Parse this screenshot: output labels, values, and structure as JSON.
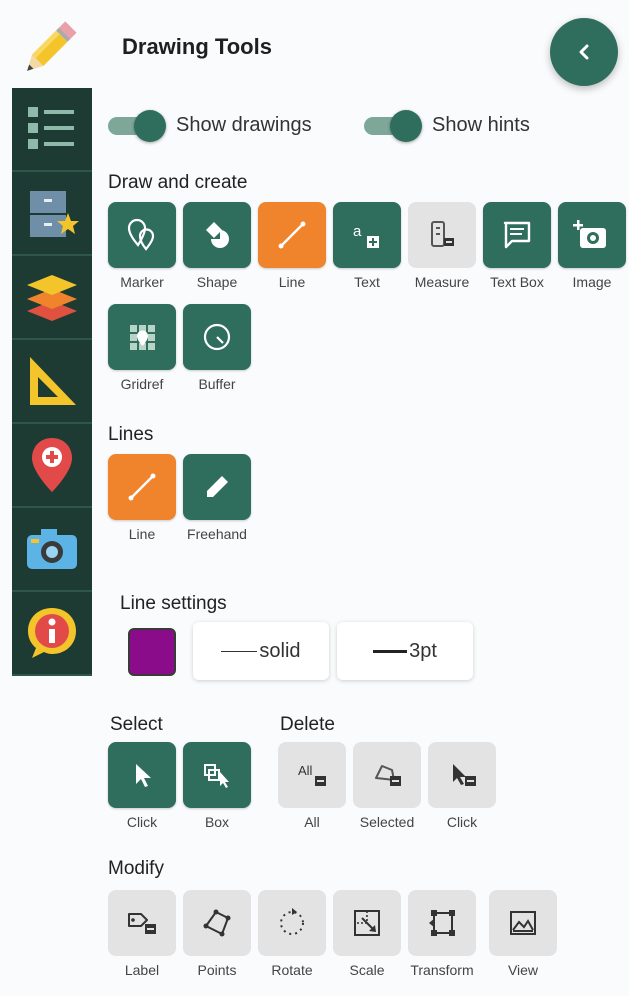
{
  "header": {
    "title": "Drawing Tools"
  },
  "toggles": [
    {
      "label": "Show drawings",
      "on": true
    },
    {
      "label": "Show hints",
      "on": true
    }
  ],
  "sections": {
    "draw": "Draw and create",
    "lines": "Lines",
    "line_settings": "Line settings",
    "select": "Select",
    "delete": "Delete",
    "modify": "Modify"
  },
  "draw_tools": [
    {
      "label": "Marker",
      "icon": "marker-icon"
    },
    {
      "label": "Shape",
      "icon": "shape-icon"
    },
    {
      "label": "Line",
      "icon": "line-icon",
      "active": true
    },
    {
      "label": "Text",
      "icon": "text-icon"
    },
    {
      "label": "Measure",
      "icon": "measure-icon",
      "disabled": true
    },
    {
      "label": "Text Box",
      "icon": "text-box-icon"
    },
    {
      "label": "Image",
      "icon": "image-icon"
    },
    {
      "label": "Gridref",
      "icon": "gridref-icon"
    },
    {
      "label": "Buffer",
      "icon": "buffer-icon"
    }
  ],
  "line_tools": [
    {
      "label": "Line",
      "icon": "line-icon",
      "active": true
    },
    {
      "label": "Freehand",
      "icon": "pencil-icon"
    }
  ],
  "line_settings": {
    "color": "#8a0c8a",
    "style": "solid",
    "width": "3pt"
  },
  "select_tools": [
    {
      "label": "Click",
      "icon": "cursor-icon"
    },
    {
      "label": "Box",
      "icon": "box-select-icon"
    }
  ],
  "delete_tools": [
    {
      "label": "All",
      "glyph": "All"
    },
    {
      "label": "Selected"
    },
    {
      "label": "Click"
    }
  ],
  "modify_tools": [
    {
      "label": "Label"
    },
    {
      "label": "Points"
    },
    {
      "label": "Rotate"
    },
    {
      "label": "Scale"
    },
    {
      "label": "Transform"
    },
    {
      "label": "View"
    }
  ],
  "colors": {
    "primary": "#2f6e5d",
    "active": "#f0842c",
    "sidebar": "#1e3b33",
    "disabled": "#e3e3e3"
  }
}
